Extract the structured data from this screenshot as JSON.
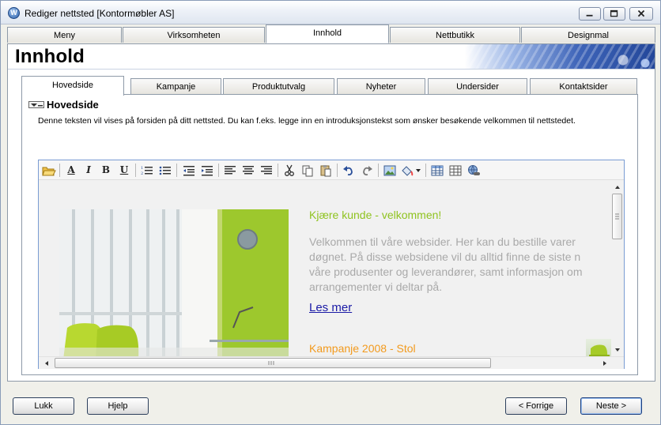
{
  "window": {
    "title": "Rediger nettsted [Kontormøbler AS]"
  },
  "top_tabs": [
    {
      "label": "Meny",
      "active": false
    },
    {
      "label": "Virksomheten",
      "active": false
    },
    {
      "label": "Innhold",
      "active": true
    },
    {
      "label": "Nettbutikk",
      "active": false
    },
    {
      "label": "Designmal",
      "active": false
    }
  ],
  "page": {
    "heading": "Innhold"
  },
  "inner_tabs": [
    {
      "label": "Hovedside",
      "active": true
    },
    {
      "label": "Kampanje",
      "active": false
    },
    {
      "label": "Produktutvalg",
      "active": false
    },
    {
      "label": "Nyheter",
      "active": false
    },
    {
      "label": "Undersider",
      "active": false
    },
    {
      "label": "Kontaktsider",
      "active": false
    }
  ],
  "section": {
    "title": "Hovedside",
    "description": "Denne teksten vil vises på forsiden på ditt nettsted. Du kan f.eks. legge inn en introduksjonstekst som ønsker besøkende velkommen til nettstedet."
  },
  "toolbar": {
    "buttons": [
      "open-icon",
      "font-color-icon",
      "italic-icon",
      "bold-icon",
      "underline-icon",
      "ordered-list-icon",
      "unordered-list-icon",
      "outdent-icon",
      "indent-icon",
      "align-left-icon",
      "align-center-icon",
      "align-right-icon",
      "cut-icon",
      "copy-icon",
      "paste-icon",
      "undo-icon",
      "redo-icon",
      "image-icon",
      "background-color-icon",
      "table-icon",
      "table-properties-icon",
      "link-icon"
    ]
  },
  "editor_content": {
    "heading": "Kjære kunde - velkommen!",
    "body": "Velkommen til våre websider. Her kan du bestille varer \ndøgnet. På disse websidene vil du alltid finne de siste n\nvåre produsenter og leverandører, samt informasjon om\narrangementer vi deltar på.",
    "link": "Les mer",
    "campaign": "Kampanje 2008 - Stol"
  },
  "colors": {
    "heading_green": "#8fc31f",
    "body_gray": "#a9a9a9",
    "link_blue": "#1a1aa6",
    "campaign_orange": "#f29a1d"
  },
  "buttons": {
    "close": "Lukk",
    "help": "Hjelp",
    "previous": "< Forrige",
    "next": "Neste >"
  }
}
